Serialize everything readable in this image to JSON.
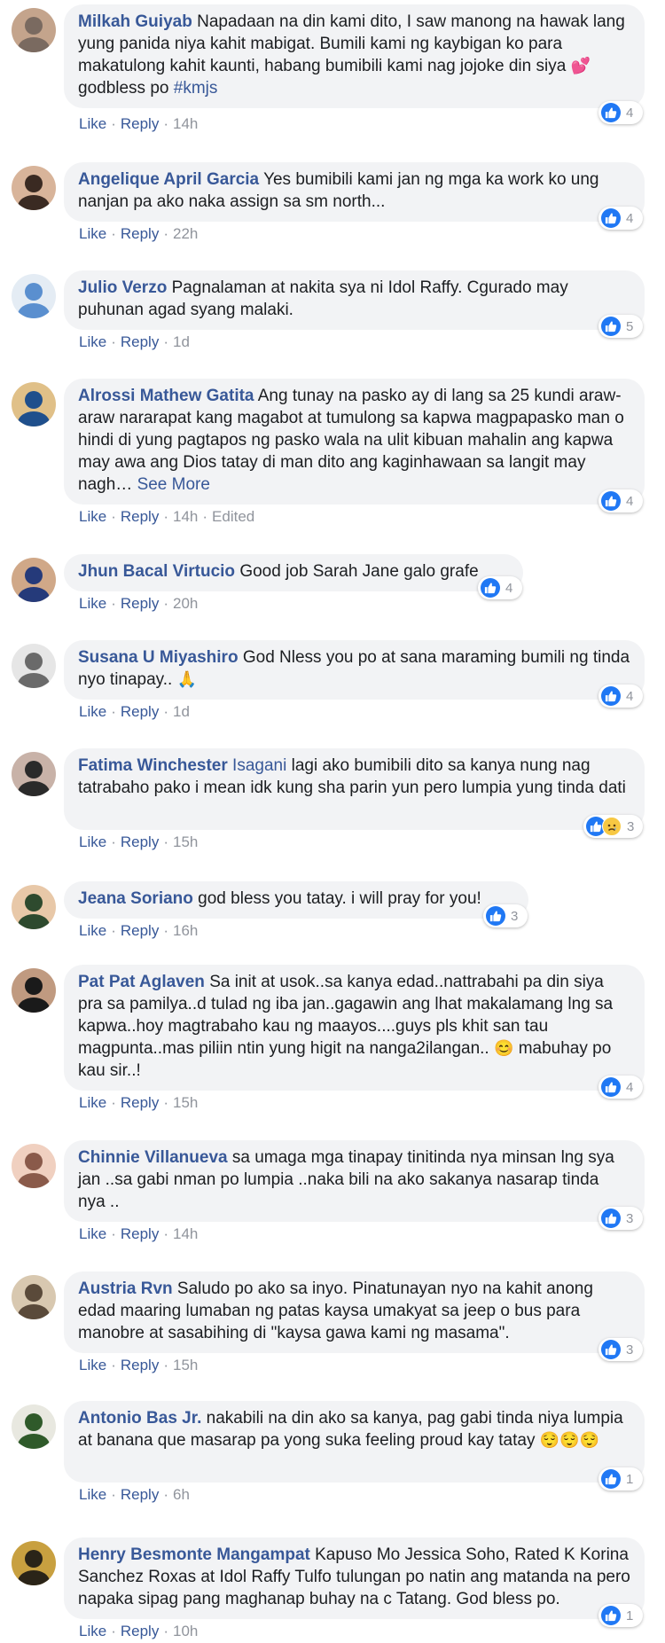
{
  "actions": {
    "like": "Like",
    "reply": "Reply"
  },
  "comments": [
    {
      "author": "Milkah Guiyab",
      "text": "Napadaan na din kami dito, I saw manong na hawak lang yung panida niya kahit mabigat. Bumili kami ng kaybigan ko para makatulong kahit kaunti, habang bumibili kami nag jojoke din siya",
      "emoji": "💕",
      "after_emoji": " godbless po ",
      "hashtag": "#kmjs",
      "time": "14h",
      "reactions": "4",
      "colors": [
        "#7a6a60",
        "#c4a48c"
      ]
    },
    {
      "author": "Angelique April Garcia",
      "text": "Yes bumibili kami jan ng mga ka work ko ung nanjan pa ako naka assign sa sm north...",
      "time": "22h",
      "reactions": "4",
      "colors": [
        "#3a2a22",
        "#d8b49a"
      ]
    },
    {
      "author": "Julio Verzo",
      "text": "Pagnalaman at nakita sya ni Idol Raffy. Cgurado may puhunan agad syang malaki.",
      "time": "1d",
      "reactions": "5",
      "colors": [
        "#5a8fcf",
        "#e4ecf4"
      ]
    },
    {
      "author": "Alrossi Mathew Gatita",
      "text": "Ang tunay na pasko ay di lang sa 25 kundi araw-araw nararapat kang magabot at tumulong sa kapwa magpapasko man o hindi di yung pagtapos ng pasko wala na ulit kibuan mahalin ang kapwa may awa ang Dios tatay di man dito ang kaginhawaan sa langit may nagh…",
      "see_more": "See More",
      "time": "14h",
      "edited": "Edited",
      "reactions": "4",
      "colors": [
        "#1f4f8c",
        "#e0c088"
      ]
    },
    {
      "author": "Jhun Bacal Virtucio",
      "text": "Good job Sarah Jane galo grafe",
      "time": "20h",
      "reactions": "4",
      "colors": [
        "#253a7a",
        "#d0a888"
      ]
    },
    {
      "author": "Susana U Miyashiro",
      "text": "God Nless you po at sana maraming bumili ng tinda nyo tinapay..",
      "emoji": "🙏",
      "time": "1d",
      "reactions": "4",
      "colors": [
        "#6a6a6a",
        "#e6e6e6"
      ]
    },
    {
      "author": "Fatima Winchester",
      "mention": "Isagani",
      "text": " lagi ako bumibili dito sa kanya nung nag tatrabaho pako i mean idk kung sha parin yun pero lumpia yung tinda dati",
      "time": "15h",
      "reactions": "3",
      "colors": [
        "#2a2a2a",
        "#c8b2a8"
      ]
    },
    {
      "author": "Jeana Soriano",
      "text": "god bless you tatay. i will pray for you!",
      "time": "16h",
      "reactions": "3",
      "colors": [
        "#2e4a2e",
        "#e8c8a8"
      ]
    },
    {
      "author": "Pat Pat Aglaven",
      "text": "Sa init at usok..sa kanya edad..nattrabahi pa din siya pra sa pamilya..d tulad ng iba jan..gagawin ang lhat makalamang lng sa kapwa..hoy magtrabaho kau ng maayos....guys pls khit san tau magpunta..mas piliin ntin yung higit na nanga2ilangan..",
      "emoji": "😊",
      "after_emoji": " mabuhay po kau sir..!",
      "time": "15h",
      "reactions": "4",
      "colors": [
        "#1a1a1a",
        "#c09a80"
      ]
    },
    {
      "author": "Chinnie Villanueva",
      "text": "sa umaga mga tinapay tinitinda nya minsan lng sya jan ..sa gabi nman po lumpia ..naka bili na ako sakanya nasarap tinda nya ..",
      "time": "14h",
      "reactions": "3",
      "colors": [
        "#8a5a4a",
        "#f0d0c0"
      ]
    },
    {
      "author": "Austria Rvn",
      "text": "Saludo po ako sa inyo. Pinatunayan nyo na kahit anong edad maaring lumaban ng patas kaysa umakyat sa jeep o bus para manobre at sasabihing di \"kaysa gawa kami ng masama\".",
      "time": "15h",
      "reactions": "3",
      "colors": [
        "#5a4a3a",
        "#d8c8b0"
      ]
    },
    {
      "author": "Antonio Bas Jr.",
      "text": "nakabili na din ako sa kanya, pag gabi tinda niya lumpia at banana que masarap pa yong suka feeling proud kay tatay",
      "emoji": "😌😌😌",
      "time": "6h",
      "reactions": "1",
      "colors": [
        "#2f5a2a",
        "#e8e8e0"
      ]
    },
    {
      "author": "Henry Besmonte Mangampat",
      "text": "Kapuso Mo Jessica Soho, Rated K Korina Sanchez Roxas at Idol Raffy Tulfo tulungan po natin ang matanda na pero napaka sipag pang maghanap buhay na c Tatang. God bless po.",
      "time": "10h",
      "reactions": "1",
      "colors": [
        "#2a2418",
        "#c8a040"
      ]
    }
  ]
}
